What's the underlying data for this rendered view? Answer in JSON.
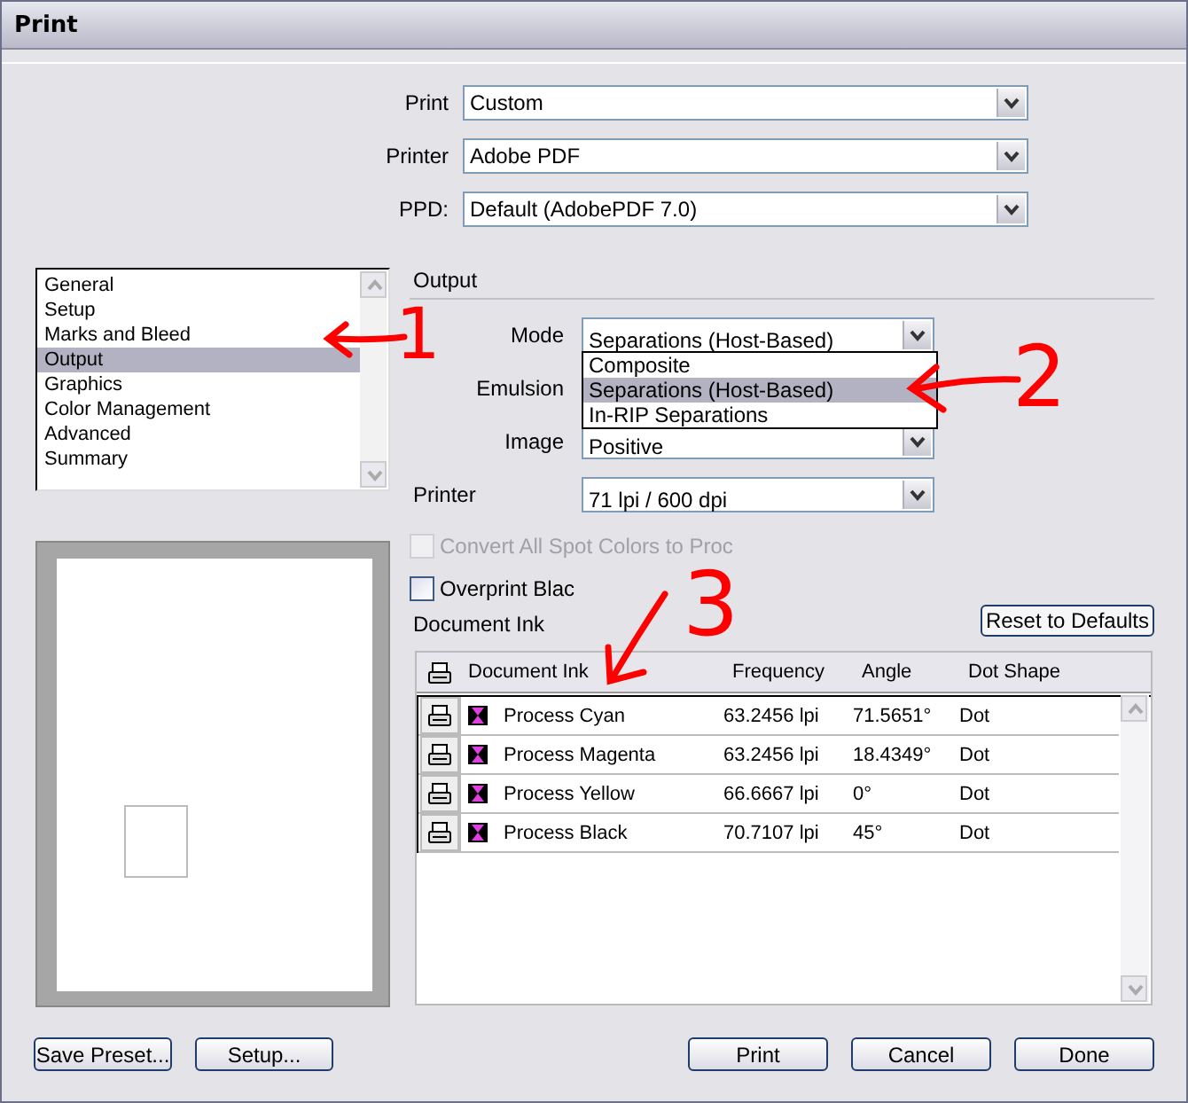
{
  "window": {
    "title": "Print"
  },
  "top_fields": [
    {
      "label": "Print",
      "value": "Custom"
    },
    {
      "label": "Printer",
      "value": "Adobe PDF"
    },
    {
      "label": "PPD:",
      "value": "Default (AdobePDF 7.0)"
    }
  ],
  "sidebar": {
    "items": [
      {
        "label": "General",
        "selected": false
      },
      {
        "label": "Setup",
        "selected": false
      },
      {
        "label": "Marks and Bleed",
        "selected": false
      },
      {
        "label": "Output",
        "selected": true
      },
      {
        "label": "Graphics",
        "selected": false
      },
      {
        "label": "Color Management",
        "selected": false
      },
      {
        "label": "Advanced",
        "selected": false
      },
      {
        "label": "Summary",
        "selected": false
      }
    ]
  },
  "output": {
    "heading": "Output",
    "fields": [
      {
        "kind": "inset",
        "label": "Mode",
        "value": "Separations (Host-Based)"
      },
      {
        "kind": "inset",
        "label": "Emulsion"
      },
      {
        "kind": "inset",
        "label": "Image",
        "value": "Positive"
      },
      {
        "kind": "flush",
        "label": "Printer",
        "value": "71 lpi / 600 dpi"
      }
    ],
    "mode_menu": [
      {
        "label": "Composite",
        "selected": false
      },
      {
        "label": "Separations (Host-Based)",
        "selected": true
      },
      {
        "label": "In-RIP Separations",
        "selected": false
      }
    ],
    "checkboxes": [
      {
        "label": "Convert All Spot Colors to Proc",
        "checked": false,
        "disabled": true
      },
      {
        "label": "Overprint Blac",
        "checked": false,
        "disabled": false
      }
    ]
  },
  "ink": {
    "heading": "Document Ink",
    "reset_button": "Reset to Defaults",
    "columns": [
      "Document Ink",
      "Frequency",
      "Angle",
      "Dot Shape"
    ],
    "rows": [
      {
        "name": "Process Cyan",
        "frequency": "63.2456 lpi",
        "angle": "71.5651°",
        "dot_shape": "Dot"
      },
      {
        "name": "Process Magenta",
        "frequency": "63.2456 lpi",
        "angle": "18.4349°",
        "dot_shape": "Dot"
      },
      {
        "name": "Process Yellow",
        "frequency": "66.6667 lpi",
        "angle": "0°",
        "dot_shape": "Dot"
      },
      {
        "name": "Process Black",
        "frequency": "70.7107 lpi",
        "angle": "45°",
        "dot_shape": "Dot"
      }
    ]
  },
  "buttons_left": [
    "Save Preset...",
    "Setup..."
  ],
  "buttons_right": [
    "Print",
    "Cancel",
    "Done"
  ],
  "annotations": [
    {
      "text": "1"
    },
    {
      "text": "2"
    },
    {
      "text": "3"
    }
  ]
}
